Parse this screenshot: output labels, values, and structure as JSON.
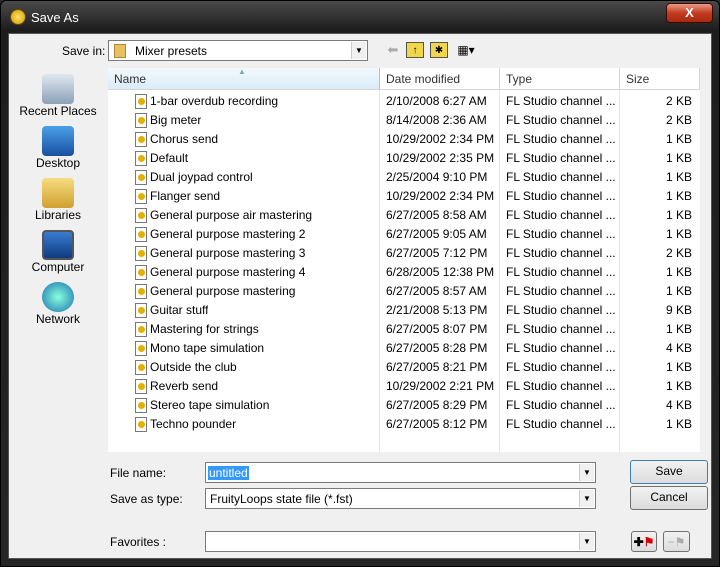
{
  "window": {
    "title": "Save As",
    "close_label": "X"
  },
  "toolbar": {
    "save_in_label": "Save in:",
    "save_in_value": "Mixer presets",
    "icons": [
      "back-arrow-icon",
      "up-folder-icon",
      "new-folder-icon",
      "view-menu-icon"
    ]
  },
  "places": [
    {
      "label": "Recent Places"
    },
    {
      "label": "Desktop"
    },
    {
      "label": "Libraries"
    },
    {
      "label": "Computer"
    },
    {
      "label": "Network"
    }
  ],
  "columns": [
    "Name",
    "Date modified",
    "Type",
    "Size"
  ],
  "files": [
    {
      "name": "1-bar overdub recording",
      "date": "2/10/2008 6:27 AM",
      "type": "FL Studio channel ...",
      "size": "2 KB"
    },
    {
      "name": "Big meter",
      "date": "8/14/2008 2:36 AM",
      "type": "FL Studio channel ...",
      "size": "2 KB"
    },
    {
      "name": "Chorus send",
      "date": "10/29/2002 2:34 PM",
      "type": "FL Studio channel ...",
      "size": "1 KB"
    },
    {
      "name": "Default",
      "date": "10/29/2002 2:35 PM",
      "type": "FL Studio channel ...",
      "size": "1 KB"
    },
    {
      "name": "Dual joypad control",
      "date": "2/25/2004 9:10 PM",
      "type": "FL Studio channel ...",
      "size": "1 KB"
    },
    {
      "name": "Flanger send",
      "date": "10/29/2002 2:34 PM",
      "type": "FL Studio channel ...",
      "size": "1 KB"
    },
    {
      "name": "General purpose air mastering",
      "date": "6/27/2005 8:58 AM",
      "type": "FL Studio channel ...",
      "size": "1 KB"
    },
    {
      "name": "General purpose mastering 2",
      "date": "6/27/2005 9:05 AM",
      "type": "FL Studio channel ...",
      "size": "1 KB"
    },
    {
      "name": "General purpose mastering 3",
      "date": "6/27/2005 7:12 PM",
      "type": "FL Studio channel ...",
      "size": "2 KB"
    },
    {
      "name": "General purpose mastering 4",
      "date": "6/28/2005 12:38 PM",
      "type": "FL Studio channel ...",
      "size": "1 KB"
    },
    {
      "name": "General purpose mastering",
      "date": "6/27/2005 8:57 AM",
      "type": "FL Studio channel ...",
      "size": "1 KB"
    },
    {
      "name": "Guitar stuff",
      "date": "2/21/2008 5:13 PM",
      "type": "FL Studio channel ...",
      "size": "9 KB"
    },
    {
      "name": "Mastering for strings",
      "date": "6/27/2005 8:07 PM",
      "type": "FL Studio channel ...",
      "size": "1 KB"
    },
    {
      "name": "Mono tape simulation",
      "date": "6/27/2005 8:28 PM",
      "type": "FL Studio channel ...",
      "size": "4 KB"
    },
    {
      "name": "Outside the club",
      "date": "6/27/2005 8:21 PM",
      "type": "FL Studio channel ...",
      "size": "1 KB"
    },
    {
      "name": "Reverb send",
      "date": "10/29/2002 2:21 PM",
      "type": "FL Studio channel ...",
      "size": "1 KB"
    },
    {
      "name": "Stereo tape simulation",
      "date": "6/27/2005 8:29 PM",
      "type": "FL Studio channel ...",
      "size": "4 KB"
    },
    {
      "name": "Techno pounder",
      "date": "6/27/2005 8:12 PM",
      "type": "FL Studio channel ...",
      "size": "1 KB"
    }
  ],
  "form": {
    "file_name_label": "File name:",
    "file_name_value": "untitled",
    "type_label": "Save as type:",
    "type_value": "FruityLoops state file (*.fst)",
    "favorites_label": "Favorites :",
    "favorites_value": ""
  },
  "buttons": {
    "save": "Save",
    "cancel": "Cancel"
  }
}
